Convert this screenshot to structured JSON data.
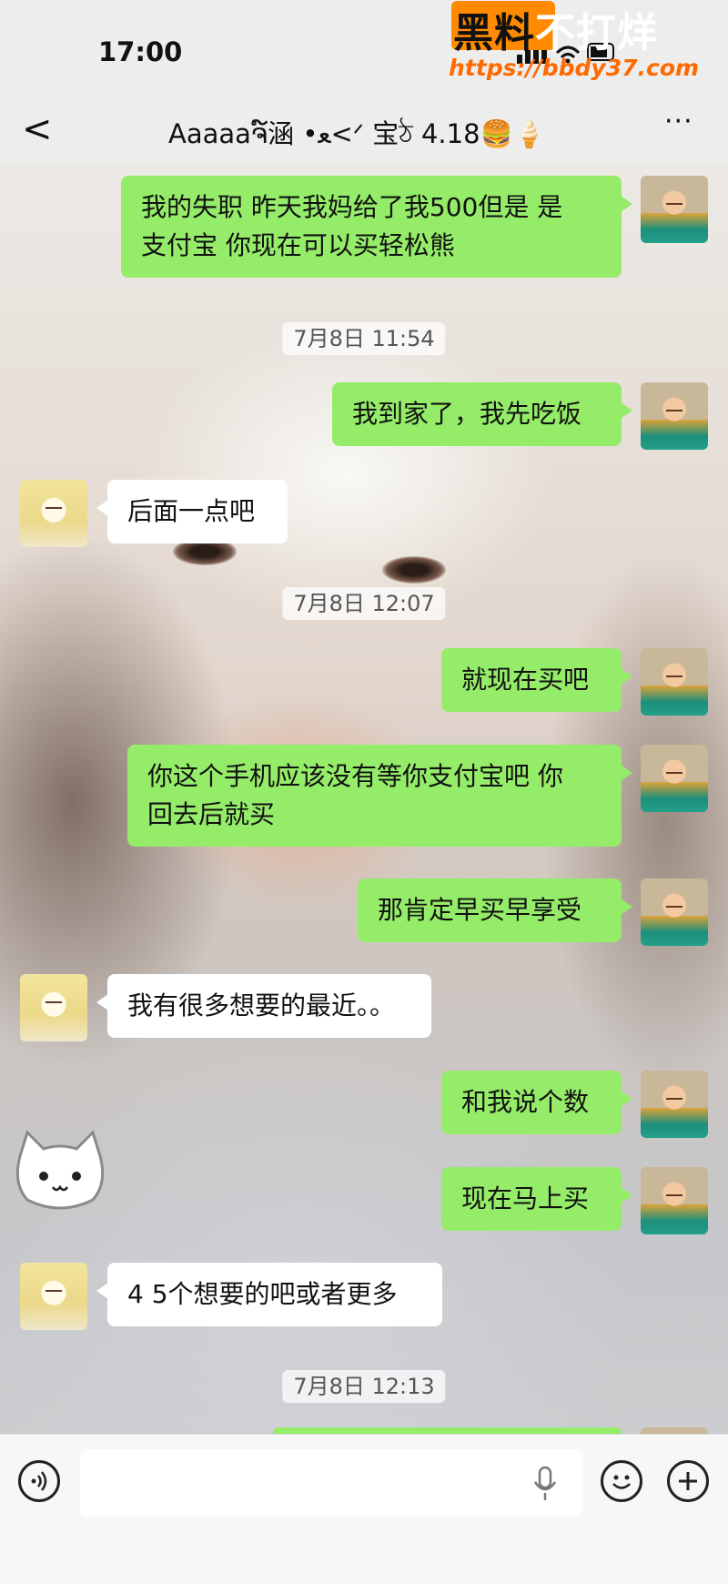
{
  "status_bar": {
    "time": "17:00"
  },
  "watermark": {
    "brand_dark": "黑料",
    "brand_light": "不打烊",
    "url": "https://bbdy37.com"
  },
  "nav": {
    "back": "<",
    "title": "Aaaaaຈ໌涵 •ﻌ<ᐟ 宝ঠ 4.18🍔🍦",
    "more": "···"
  },
  "messages": [
    {
      "side": "me",
      "text": "我的失职 昨天我妈给了我500但是 是\n支付宝 你现在可以买轻松熊"
    },
    {
      "side": "time",
      "text": "7月8日 11:54"
    },
    {
      "side": "me",
      "text": "我到家了，我先吃饭"
    },
    {
      "side": "her",
      "text": "后面一点吧"
    },
    {
      "side": "time",
      "text": "7月8日 12:07"
    },
    {
      "side": "me",
      "text": "就现在买吧"
    },
    {
      "side": "me",
      "text": "你这个手机应该没有等你支付宝吧 你\n回去后就买"
    },
    {
      "side": "me",
      "text": "那肯定早买早享受"
    },
    {
      "side": "her",
      "text": "我有很多想要的最近。。"
    },
    {
      "side": "me",
      "text": "和我说个数"
    },
    {
      "side": "me",
      "text": "现在马上买"
    },
    {
      "side": "her",
      "text": "4 5个想要的吧或者更多"
    },
    {
      "side": "time",
      "text": "7月8日 12:13"
    }
  ],
  "icons": [
    "back-icon",
    "more-icon",
    "voice-icon",
    "mic-icon",
    "emoji-icon",
    "plus-icon",
    "cat-sticker"
  ],
  "colors": {
    "sent_bubble": "#95ec69",
    "recv_bubble": "#ffffff",
    "bar_bg": "#ededed",
    "watermark_orange": "#ff8a00"
  }
}
